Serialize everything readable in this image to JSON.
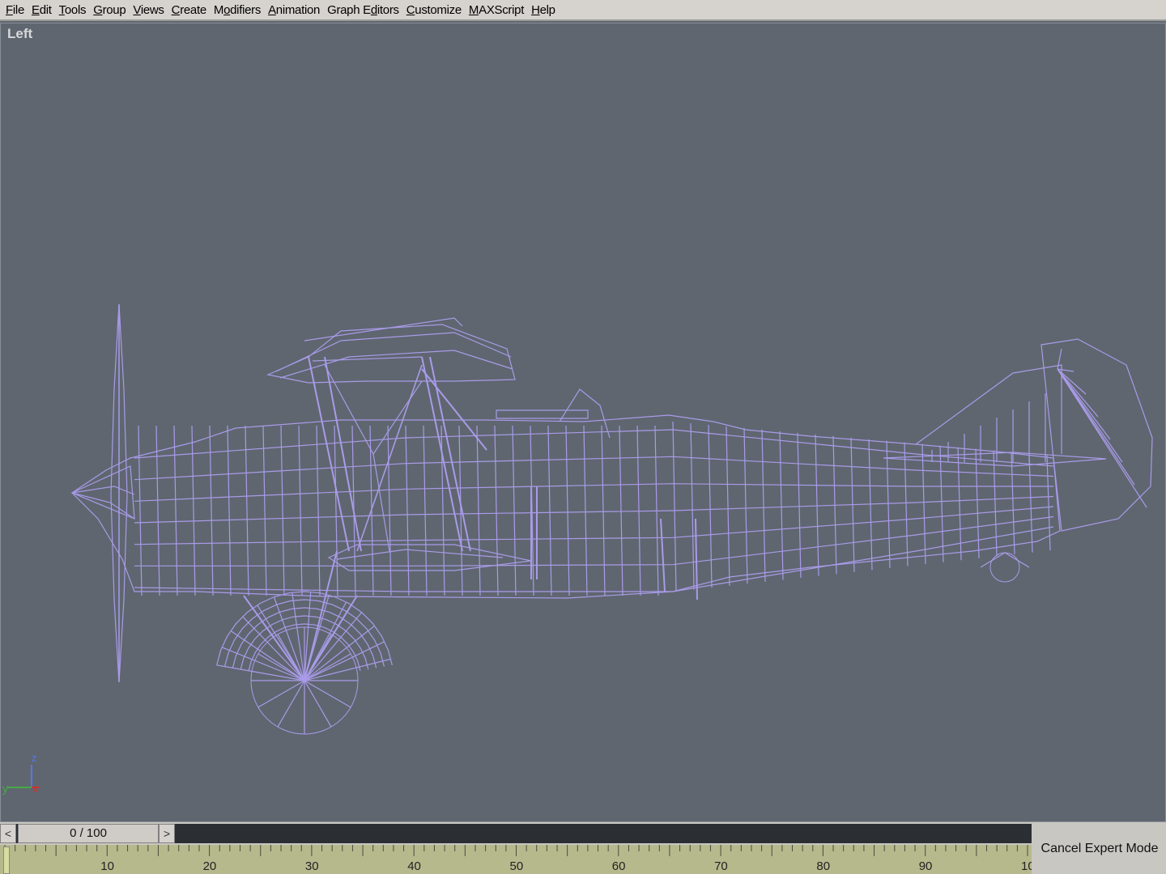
{
  "menu": [
    {
      "pre": "",
      "ul": "F",
      "post": "ile",
      "id": "menu-file"
    },
    {
      "pre": "",
      "ul": "E",
      "post": "dit",
      "id": "menu-edit"
    },
    {
      "pre": "",
      "ul": "T",
      "post": "ools",
      "id": "menu-tools"
    },
    {
      "pre": "",
      "ul": "G",
      "post": "roup",
      "id": "menu-group"
    },
    {
      "pre": "",
      "ul": "V",
      "post": "iews",
      "id": "menu-views"
    },
    {
      "pre": "",
      "ul": "C",
      "post": "reate",
      "id": "menu-create"
    },
    {
      "pre": "M",
      "ul": "o",
      "post": "difiers",
      "id": "menu-modifiers"
    },
    {
      "pre": "",
      "ul": "A",
      "post": "nimation",
      "id": "menu-animation"
    },
    {
      "pre": "Graph E",
      "ul": "d",
      "post": "itors",
      "id": "menu-graph-editors"
    },
    {
      "pre": "",
      "ul": "C",
      "post": "ustomize",
      "id": "menu-customize"
    },
    {
      "pre": "",
      "ul": "M",
      "post": "AXScript",
      "id": "menu-maxscript"
    },
    {
      "pre": "",
      "ul": "H",
      "post": "elp",
      "id": "menu-help"
    }
  ],
  "viewport": {
    "label": "Left",
    "wireframe_color": "#a99be8",
    "background_color": "#5f6670"
  },
  "axes": {
    "z": "z",
    "y": "y",
    "x": "x"
  },
  "time_slider": {
    "prev": "<",
    "next": ">",
    "frame_display": "0 / 100"
  },
  "timeline": {
    "tick_labels": [
      "10",
      "20",
      "30",
      "40",
      "50",
      "60",
      "70",
      "80",
      "90",
      "10"
    ]
  },
  "cancel_expert_mode": "Cancel Expert Mode"
}
